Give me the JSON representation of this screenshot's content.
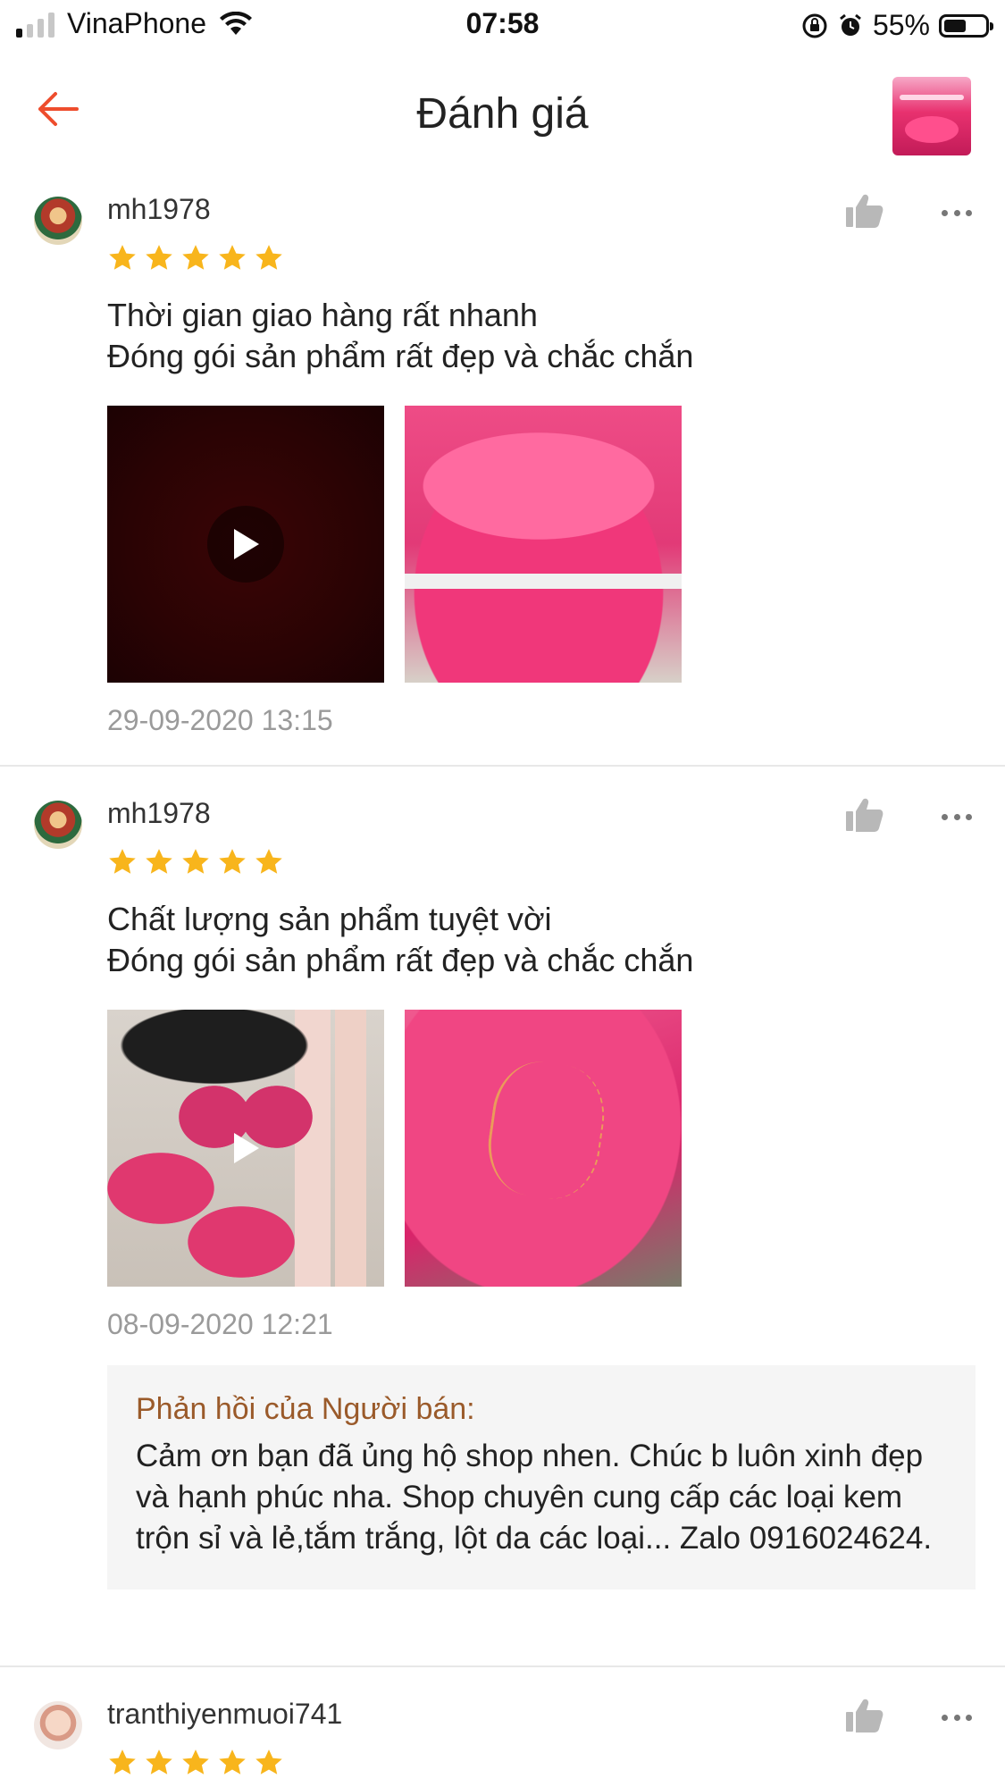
{
  "status_bar": {
    "carrier": "VinaPhone",
    "time": "07:58",
    "battery": "55%",
    "battery_level": 0.55
  },
  "header": {
    "title": "Đánh giá",
    "back_icon": "arrow-left-icon",
    "accent_color": "#ee4d2d"
  },
  "reviews": [
    {
      "username": "mh1978",
      "rating": 5,
      "text": "Thời gian giao hàng rất nhanh\nĐóng gói sản phẩm rất đẹp và chắc chắn",
      "timestamp": "29-09-2020 13:15",
      "media": [
        "video",
        "image"
      ]
    },
    {
      "username": "mh1978",
      "rating": 5,
      "text": "Chất lượng sản phẩm tuyệt vời\nĐóng gói sản phẩm rất đẹp và chắc chắn",
      "timestamp": "08-09-2020 12:21",
      "media": [
        "video",
        "image"
      ],
      "seller_reply": {
        "title": "Phản hồi của Người bán:",
        "text": "Cảm ơn bạn đã ủng hộ shop nhen. Chúc b luôn xinh đẹp và hạnh phúc nha. Shop chuyên cung cấp các loại kem trộn sỉ và lẻ,tắm trắng, lột da các loại... Zalo 0916024624."
      }
    },
    {
      "username": "tranthiyenmuoi741",
      "rating": 5
    }
  ],
  "colors": {
    "star": "#f8b51c",
    "reply_title": "#9a5a2a",
    "timestamp": "#9a9a9a"
  }
}
